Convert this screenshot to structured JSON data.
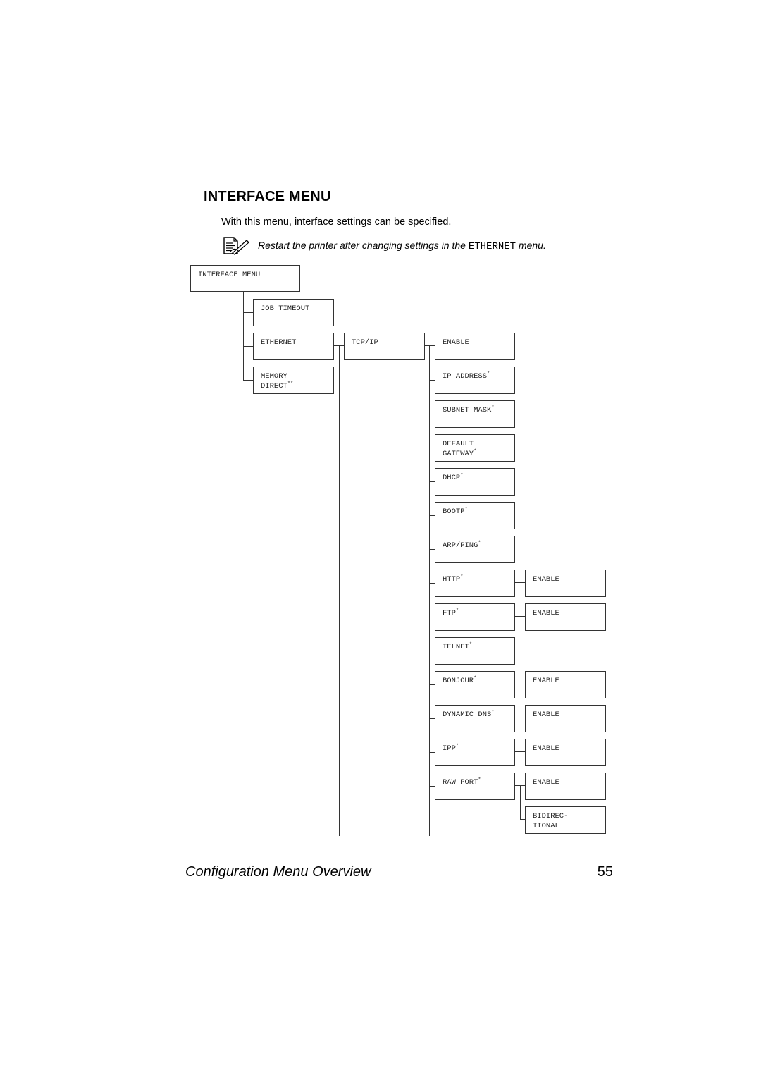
{
  "heading": "INTERFACE MENU",
  "intro": "With this menu, interface settings can be specified.",
  "note": {
    "icon": "note-pencil-icon",
    "text_before": "Restart the printer after changing settings in the ",
    "code": "ETHERNET",
    "text_after": " menu."
  },
  "tree": {
    "root": "INTERFACE MENU",
    "level1": [
      {
        "label": "JOB TIMEOUT",
        "mark": ""
      },
      {
        "label": "ETHERNET",
        "mark": ""
      },
      {
        "label": "MEMORY\nDIRECT",
        "mark": "**"
      }
    ],
    "tcpip": "TCP/IP",
    "tcpip_items": [
      {
        "label": "ENABLE",
        "mark": ""
      },
      {
        "label": "IP ADDRESS",
        "mark": "*"
      },
      {
        "label": "SUBNET MASK",
        "mark": "*"
      },
      {
        "label": "DEFAULT\nGATEWAY",
        "mark": "*"
      },
      {
        "label": "DHCP",
        "mark": "*"
      },
      {
        "label": "BOOTP",
        "mark": "*"
      },
      {
        "label": "ARP/PING",
        "mark": "*"
      },
      {
        "label": "HTTP",
        "mark": "*"
      },
      {
        "label": "FTP",
        "mark": "*"
      },
      {
        "label": "TELNET",
        "mark": "*"
      },
      {
        "label": "BONJOUR",
        "mark": "*"
      },
      {
        "label": "DYNAMIC DNS",
        "mark": "*"
      },
      {
        "label": "IPP",
        "mark": "*"
      },
      {
        "label": "RAW PORT",
        "mark": "*"
      }
    ],
    "sub_items": {
      "HTTP": [
        "ENABLE"
      ],
      "FTP": [
        "ENABLE"
      ],
      "BONJOUR": [
        "ENABLE"
      ],
      "DYNAMIC DNS": [
        "ENABLE"
      ],
      "IPP": [
        "ENABLE"
      ],
      "RAW PORT": [
        "ENABLE",
        "BIDIREC-\nTIONAL"
      ]
    }
  },
  "footer": {
    "title": "Configuration Menu Overview",
    "page": "55"
  }
}
